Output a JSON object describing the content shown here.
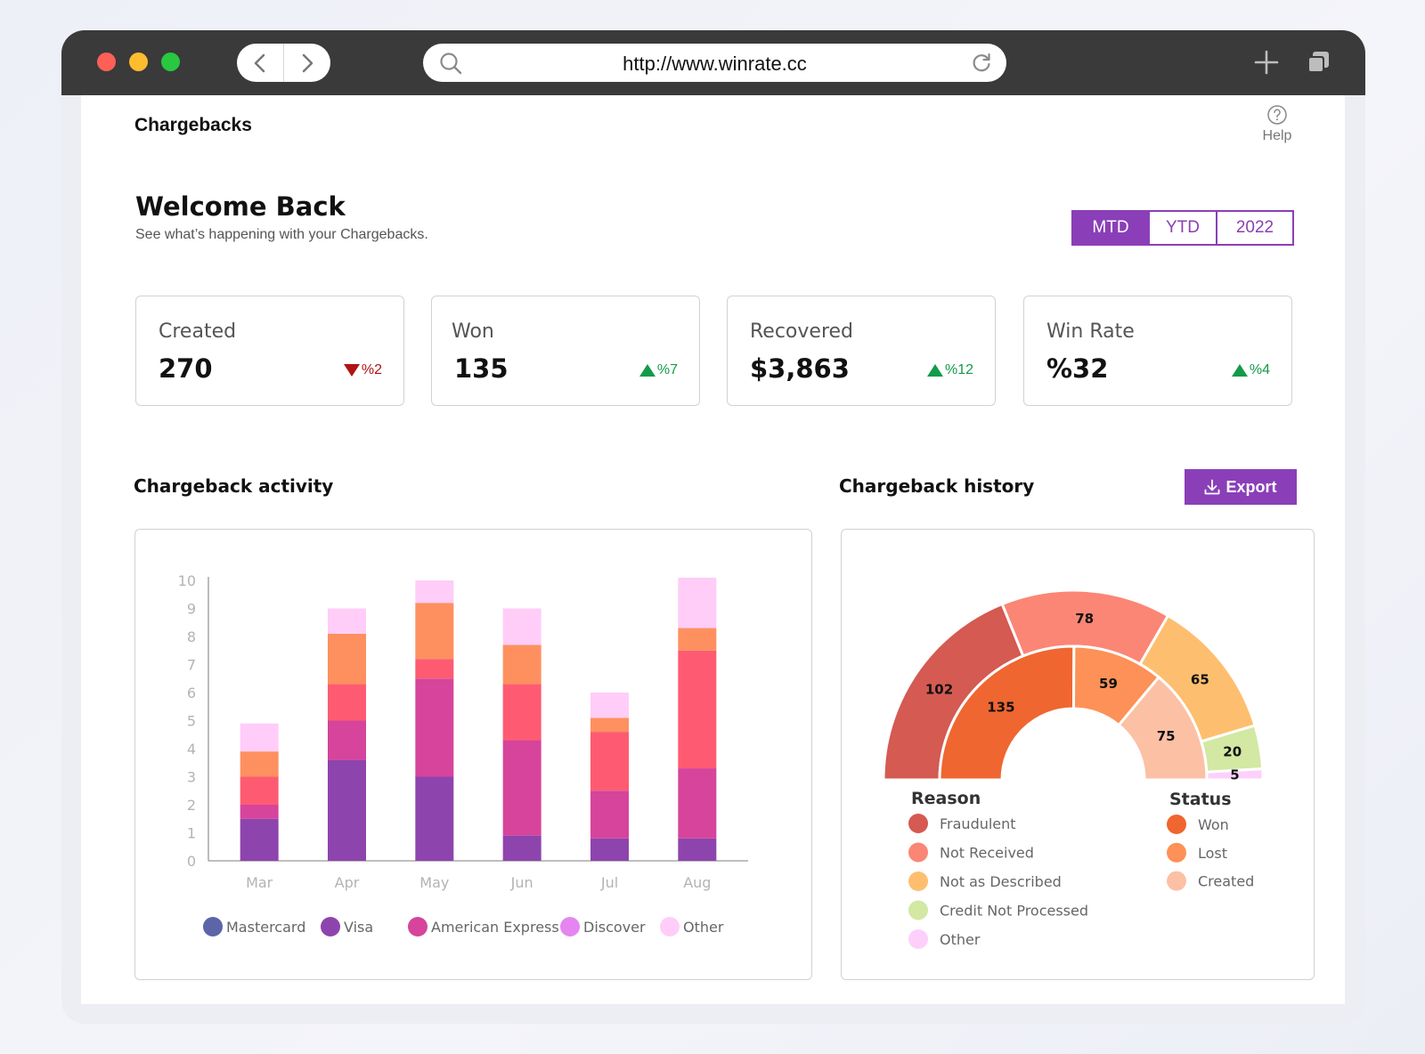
{
  "browser": {
    "url": "http://www.winrate.cc"
  },
  "header": {
    "brand": "Chargebacks",
    "help_label": "Help"
  },
  "intro": {
    "title": "Welcome Back",
    "subtitle": "See what’s happening with your Chargebacks."
  },
  "periods": [
    {
      "label": "MTD",
      "active": true
    },
    {
      "label": "YTD",
      "active": false
    },
    {
      "label": "2022",
      "active": false
    }
  ],
  "kpis": [
    {
      "label": "Created",
      "value": "270",
      "delta": "%2",
      "direction": "down"
    },
    {
      "label": "Won",
      "value": "135",
      "delta": "%7",
      "direction": "up"
    },
    {
      "label": "Recovered",
      "value": "$3,863",
      "delta": "%12",
      "direction": "up"
    },
    {
      "label": "Win Rate",
      "value": "%32",
      "delta": "%4",
      "direction": "up"
    }
  ],
  "sections": {
    "activity_title": "Chargeback activity",
    "history_title": "Chargeback history",
    "export_label": "Export"
  },
  "colors": {
    "accent": "#8a3fb8",
    "up": "#149a48",
    "down": "#b01313"
  },
  "chart_data": [
    {
      "type": "bar",
      "stacked": true,
      "categories": [
        "Mar",
        "Apr",
        "May",
        "Jun",
        "Jul",
        "Aug"
      ],
      "ylim": [
        0,
        10
      ],
      "yticks": [
        0,
        1,
        2,
        3,
        4,
        5,
        6,
        7,
        8,
        9,
        10
      ],
      "grid": false,
      "legend_position": "bottom",
      "series": [
        {
          "name": "Mastercard",
          "color": "#5b65a8",
          "values": [
            0,
            0,
            0,
            0,
            0,
            0
          ]
        },
        {
          "name": "Visa",
          "color": "#8e44ad",
          "values": [
            1.5,
            3.6,
            3.0,
            0.9,
            0.8,
            0.8
          ]
        },
        {
          "name": "American Express",
          "color": "#d6449b",
          "values": [
            0.5,
            1.4,
            3.5,
            3.4,
            1.7,
            2.5
          ]
        },
        {
          "name": "",
          "color": "#fe5b72",
          "values": [
            1.0,
            1.3,
            0.7,
            2.0,
            2.1,
            4.2
          ]
        },
        {
          "name": "Discover",
          "color": "#fe9060",
          "values": [
            0.9,
            1.8,
            2.0,
            1.4,
            0.5,
            0.8
          ]
        },
        {
          "name": "Other",
          "color": "#ffcdf8",
          "values": [
            1.0,
            0.9,
            0.8,
            1.3,
            0.9,
            1.8
          ]
        }
      ],
      "legend": [
        {
          "name": "Mastercard",
          "color": "#5b65a8"
        },
        {
          "name": "Visa",
          "color": "#8e44ad"
        },
        {
          "name": "American Express",
          "color": "#d6449b"
        },
        {
          "name": "Discover",
          "color": "#e586f0"
        },
        {
          "name": "Other",
          "color": "#ffcdf8"
        }
      ]
    },
    {
      "type": "pie",
      "style": "nested-semicircle",
      "outer": {
        "legend_title": "Reason",
        "slices": [
          {
            "name": "Fraudulent",
            "value": 102,
            "color": "#d45a52"
          },
          {
            "name": "Not Received",
            "value": 78,
            "color": "#fb8675"
          },
          {
            "name": "Not as Described",
            "value": 65,
            "color": "#fdbf6f"
          },
          {
            "name": "Credit Not Processed",
            "value": 20,
            "color": "#d3e8a3"
          },
          {
            "name": "Other",
            "value": 5,
            "color": "#fdd0fb"
          }
        ]
      },
      "inner": {
        "legend_title": "Status",
        "slices": [
          {
            "name": "Won",
            "value": 135,
            "color": "#ef6630"
          },
          {
            "name": "Lost",
            "value": 59,
            "color": "#fd9157"
          },
          {
            "name": "Created",
            "value": 75,
            "color": "#fcc0a4"
          }
        ]
      }
    }
  ]
}
